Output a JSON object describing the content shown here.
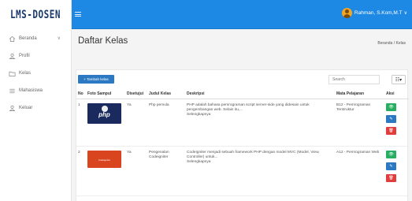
{
  "brand": "LMS-DOSEN",
  "user": {
    "name": "Rahman, S.Kom,M.T",
    "caret": "∨"
  },
  "sidebar": {
    "items": [
      {
        "label": "Beranda",
        "icon": "home-icon",
        "chevron": "∨"
      },
      {
        "label": "Profil",
        "icon": "user-icon"
      },
      {
        "label": "Kelas",
        "icon": "folder-icon"
      },
      {
        "label": "Mahasiswa",
        "icon": "list-icon"
      },
      {
        "label": "Keluar",
        "icon": "logout-icon"
      }
    ]
  },
  "page": {
    "title": "Daftar Kelas",
    "breadcrumb": "Beranda / Kelas"
  },
  "toolbar": {
    "add_label": "+ Tambah kelas",
    "search_placeholder": "Search",
    "columns_label": "☷▾"
  },
  "table": {
    "headers": [
      "No",
      "Foto Sampul",
      "Disetujui",
      "Judul Kelas",
      "Deskripsi",
      "Mata Pelajaran",
      "Aksi"
    ],
    "rows": [
      {
        "no": "1",
        "thumb_text": "php",
        "approved": "Ya",
        "title": "Php pemula",
        "description": "PHP adalah bahasa pemrograman script server-side yang didesain untuk pengembangan web. Selain itu,...",
        "more": "Selengkapnya",
        "subject": "B12 - Pemrograman Terstruktur"
      },
      {
        "no": "2",
        "thumb_text": "Codeigniter",
        "approved": "Ya",
        "title": "Pengenalan Codeigniter",
        "description": "CodeIgniter menjadi sebuah framework PHP dengan model MVC (Model, View, Controller) untuk...",
        "more": "Selengkapnya",
        "subject": "A12 - Pemrograman Web"
      }
    ]
  },
  "actions": {
    "view": "👁",
    "edit": "✎",
    "delete": "🗑"
  },
  "colors": {
    "navbar": "#1e88e5",
    "add": "#2b79c2",
    "view": "#27ae60",
    "edit": "#2b79c2",
    "delete": "#e23d3d"
  }
}
